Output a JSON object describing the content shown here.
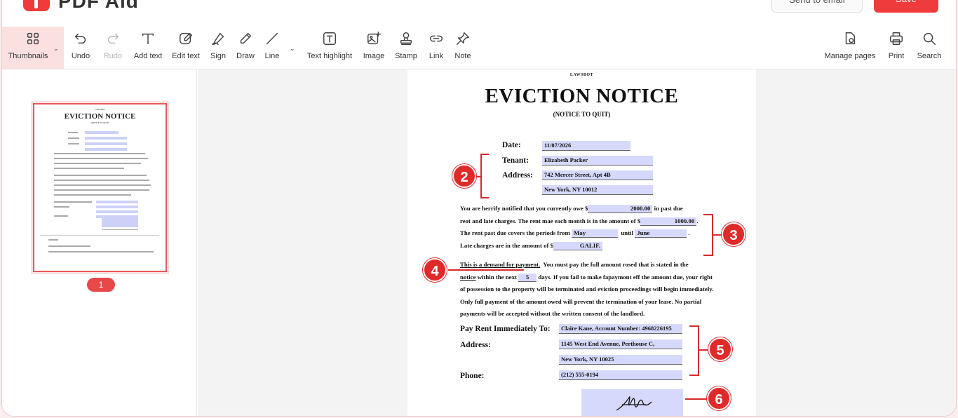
{
  "header": {
    "brand_name": "PDF Aid",
    "send_email_label": "Send to email",
    "save_label": "Save"
  },
  "toolbar": {
    "thumbnails": "Thumbnails",
    "undo": "Undo",
    "redo": "Rudo",
    "add_text": "Add text",
    "edit_text": "Edit text",
    "sign": "Sign",
    "draw": "Draw",
    "line": "Line",
    "text_highlight": "Text highlight",
    "image": "Image",
    "stamp": "Stamp",
    "link": "Link",
    "note": "Note",
    "manage_pages": "Manage pages",
    "print": "Print",
    "search": "Search"
  },
  "sidebar": {
    "page_number": "1"
  },
  "document": {
    "lawsbot": "LAWSBOT",
    "title": "EVICTION NOTICE",
    "subtitle": "(NOTICE TO QUIT)",
    "date_label": "Date:",
    "date_value": "11/07/2026",
    "tenant_label": "Tenant:",
    "tenant_value": "Elizabeth Packer",
    "address_label": "Address:",
    "address_line1": "742 Mercer Street, Apt 4B",
    "address_line2": "New York, NY 10012",
    "p1_l1a": "You are herrify notified that you currently owe $",
    "p1_owe": "2000.00",
    "p1_l1b": "in past due",
    "p1_l2a": "reot and late charges.  The rent mae each month is in the amount of $",
    "p1_rent": "1000.00",
    "p1_l3a": "The rent past due covers the periods from",
    "p1_from": "May",
    "p1_until_lbl": "until",
    "p1_until": "June",
    "p1_l4a": "Late charges are in the amount of $",
    "p1_late": "GALIF.",
    "p2_l1a": "This is a demand for payment.",
    "p2_l1b": "You must pay the full amount rosed that is stated in the",
    "p2_l2a": "notice",
    "p2_l2b": "within the next",
    "p2_days": "5",
    "p2_l2c": "days.  If you fail to make fapaymont eff the amount due, your right",
    "p2_l3": "of possession to the property will be terminated and eviction proceedings will begin immediately.",
    "p2_l4": "Only full payment of the amount owed will prevent the termination of your lease.  No partial",
    "p2_l5": "payments will be accepted without the written consent of the landlord.",
    "pay_label": "Pay Rent Immediately To:",
    "pay_value": "Claire Kane, Account Number: 4968226195",
    "pay_address_label": "Address:",
    "pay_address1": "1145 West End Avenue, Perthouse C,",
    "pay_address2": "New York, NY 10025",
    "phone_label": "Phone:",
    "phone_value": "(212) 555-0194"
  },
  "annotations": [
    "2",
    "3",
    "4",
    "5",
    "6"
  ],
  "colors": {
    "accent": "#e02a2a",
    "field_highlight": "#d6d9fb"
  }
}
